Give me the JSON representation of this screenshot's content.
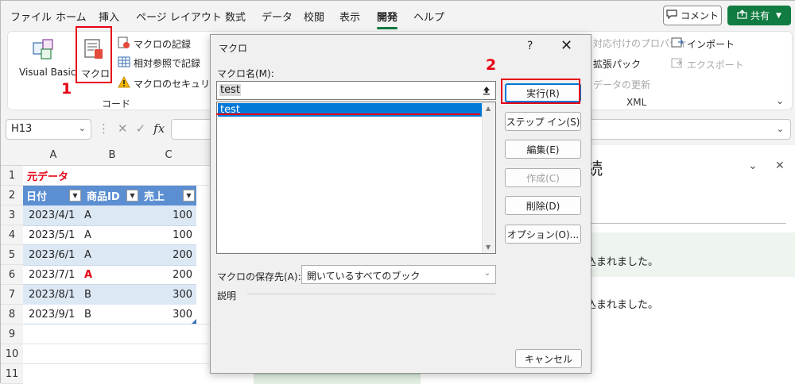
{
  "menu": {
    "tabs": [
      "ファイル",
      "ホーム",
      "挿入",
      "ページ レイアウト",
      "数式",
      "データ",
      "校閲",
      "表示",
      "開発",
      "ヘルプ"
    ],
    "active_tab": "開発",
    "comment_label": "コメント",
    "share_label": "共有"
  },
  "ribbon": {
    "visual_basic": "Visual Basic",
    "macro": "マクロ",
    "record_macro": "マクロの記録",
    "relative_ref": "相対参照で記録",
    "macro_security": "マクロのセキュリティ",
    "group_code": "コード",
    "map_properties": "対応付けのプロパティ",
    "expansion_pack": "拡張パック",
    "refresh_data": "データの更新",
    "import": "インポート",
    "export": "エクスポート",
    "group_xml": "XML"
  },
  "annotations": {
    "step1": "1",
    "step2": "2"
  },
  "formula_bar": {
    "name_box": "H13",
    "fx": "fx"
  },
  "sheet": {
    "columns": [
      "A",
      "B",
      "C"
    ],
    "rows": [
      "1",
      "2",
      "3",
      "4",
      "5",
      "6",
      "7",
      "8",
      "9",
      "10",
      "11"
    ],
    "title": "元データ",
    "headers": [
      "日付",
      "商品ID",
      "売上"
    ],
    "data": [
      [
        "2023/4/1",
        "A",
        "100"
      ],
      [
        "2023/5/1",
        "A",
        "100"
      ],
      [
        "2023/6/1",
        "A",
        "200"
      ],
      [
        "2023/7/1",
        "A",
        "200"
      ],
      [
        "2023/8/1",
        "B",
        "300"
      ],
      [
        "2023/9/1",
        "B",
        "300"
      ]
    ],
    "red_cell_color": "#e60012",
    "header_color": "#5b8fd2"
  },
  "task_pane": {
    "title_fragment": "続",
    "msg1": "込まれました。",
    "msg2": "込まれました。"
  },
  "dialog": {
    "title": "マクロ",
    "help": "?",
    "close": "✕",
    "macro_name_label": "マクロ名(M):",
    "macro_name_value": "test",
    "macros": [
      "test"
    ],
    "buttons": {
      "run": "実行(R)",
      "step_in": "ステップ イン(S)",
      "edit": "編集(E)",
      "create": "作成(C)",
      "delete": "削除(D)",
      "options": "オプション(O)...",
      "cancel": "キャンセル"
    },
    "store_label": "マクロの保存先(A):",
    "store_value": "開いているすべてのブック",
    "description_label": "説明"
  }
}
